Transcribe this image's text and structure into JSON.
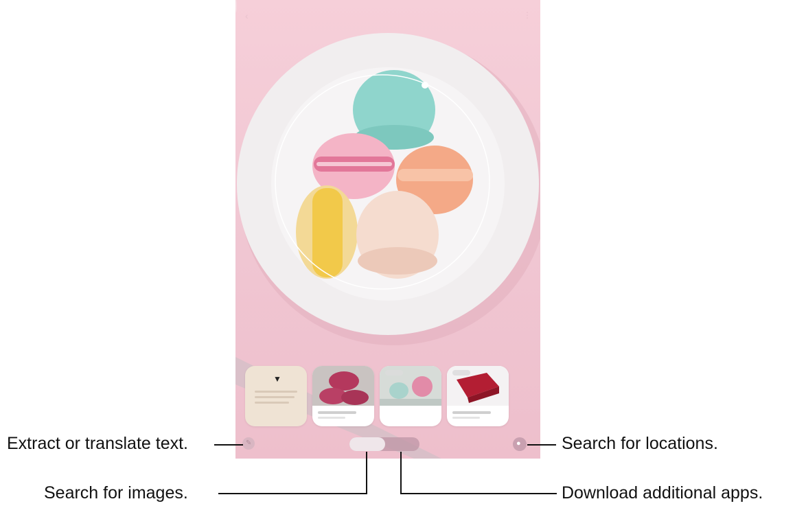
{
  "callouts": {
    "extract_text": "Extract or translate text.",
    "search_images": "Search for images.",
    "search_locations": "Search for locations.",
    "download_apps": "Download additional apps."
  },
  "screen": {
    "top_bar": {
      "back_icon": "chevron-left-icon",
      "more_icon": "more-vertical-icon"
    },
    "photo_subject": "macarons-on-plate",
    "results": [
      {
        "type": "app-suggestion"
      },
      {
        "type": "image-result",
        "thumb": "pink-macarons"
      },
      {
        "type": "image-result",
        "thumb": "decorated-cakes"
      },
      {
        "type": "image-result",
        "thumb": "red-fabric"
      }
    ],
    "controls": {
      "text_icon": "text-icon",
      "location_icon": "location-pin-icon",
      "modes": [
        "",
        ""
      ]
    }
  },
  "colors": {
    "background": "#f0c6d2",
    "plate": "#f4f1f2",
    "mint": "#8ed8cf",
    "pink": "#f3a9bd",
    "orange": "#f6b08d",
    "yellow": "#f5dca0",
    "cream": "#f5ddd1"
  }
}
